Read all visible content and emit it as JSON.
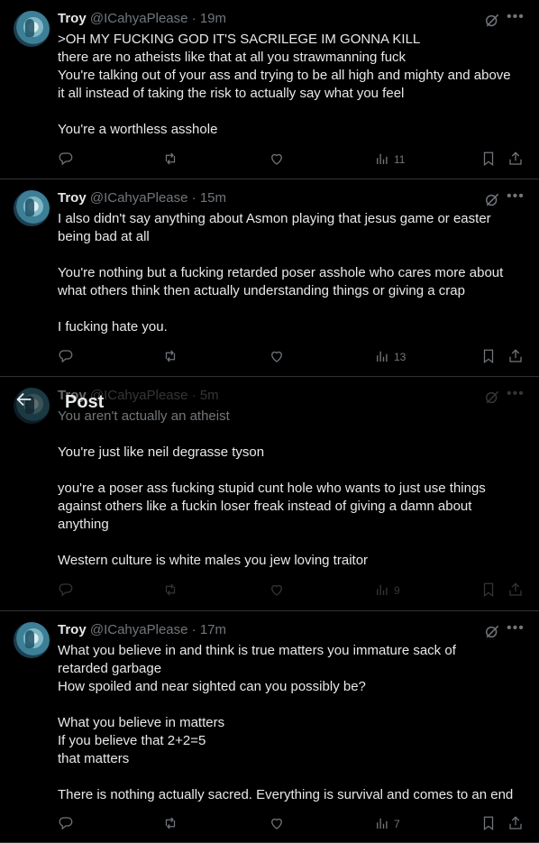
{
  "tweets": [
    {
      "name": "Troy",
      "handle": "@ICahyaPlease",
      "time": "19m",
      "lines": [
        ">OH MY FUCKING GOD IT'S SACRILEGE IM GONNA KILL",
        "there are no atheists like that at all you strawmanning fuck",
        "You're talking out of your ass and trying to be all high and mighty and above",
        "it all instead of taking the risk to actually say what you feel",
        "",
        "You're a worthless asshole"
      ],
      "views": "11"
    },
    {
      "name": "Troy",
      "handle": "@ICahyaPlease",
      "time": "15m",
      "lines": [
        "I also didn't say anything about Asmon playing that jesus game or easter",
        "being bad at all",
        "",
        "You're nothing but a fucking retarded poser asshole who cares more about",
        "what others think then actually understanding things or giving a crap",
        "",
        "I fucking hate you."
      ],
      "views": "13"
    },
    {
      "name": "Troy",
      "handle": "@ICahyaPlease",
      "time": "5m",
      "lines": [
        "You aren't actually an atheist",
        "",
        "You're just like neil degrasse tyson",
        "",
        "you're a poser ass fucking stupid cunt hole who wants to just use things",
        "against others like a fuckin loser freak instead of giving a damn about",
        "anything",
        "",
        "Western culture is white males you jew loving traitor"
      ],
      "views": "9"
    },
    {
      "name": "Troy",
      "handle": "@ICahyaPlease",
      "time": "17m",
      "lines": [
        "What you believe in and think is true matters you immature sack of",
        "retarded garbage",
        "How spoiled and near sighted can you possibly be?",
        "",
        "What you believe in matters",
        "If you believe that 2+2=5",
        "that matters",
        "",
        "There is nothing actually sacred. Everything is survival and comes to an end"
      ],
      "views": "7"
    }
  ],
  "header": {
    "title": "Post"
  },
  "colors": {
    "background": "#000000",
    "text": "#e7e9ea",
    "muted": "#71767b",
    "divider": "#2f3336"
  },
  "icons": [
    "grok-icon",
    "more-icon",
    "reply-icon",
    "repost-icon",
    "like-icon",
    "views-icon",
    "bookmark-icon",
    "share-icon",
    "back-arrow-icon"
  ]
}
